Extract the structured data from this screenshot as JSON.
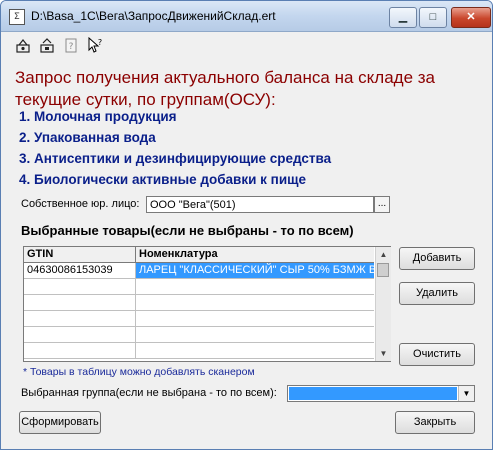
{
  "window": {
    "title": "D:\\Basa_1C\\Вега\\ЗапросДвиженийСклад.ert",
    "icon_glyph": "Σ",
    "min_glyph": "▁",
    "max_glyph": "□",
    "close_glyph": "✕"
  },
  "toolbar": {
    "icons": [
      "open-file-icon",
      "save-file-icon",
      "help-book-icon",
      "context-help-icon"
    ]
  },
  "header": {
    "title": "Запрос получения актуального баланса на складе за текущие сутки, по группам(ОСУ):"
  },
  "groups": [
    "1. Молочная продукция",
    "2. Упакованная вода",
    "3. Антисептики и дезинфицирующие средства",
    "4. Биологически активные добавки к пище"
  ],
  "legal_entity": {
    "label": "Собственное юр. лицо:",
    "value": "ООО \"Вега\"(501)",
    "button_label": "..."
  },
  "selected_goods": {
    "title": "Выбранные товары(если не выбраны - то по всем)",
    "columns": [
      "GTIN",
      "Номенклатура"
    ],
    "rows": [
      [
        "04630086153039",
        "ЛАРЕЦ \"КЛАССИЧЕСКИЙ\" СЫР 50% БЗМЖ В"
      ],
      [
        "",
        ""
      ],
      [
        "",
        ""
      ],
      [
        "",
        ""
      ],
      [
        "",
        ""
      ],
      [
        "",
        ""
      ]
    ],
    "scroll_up": "▲",
    "scroll_down": "▼"
  },
  "buttons": {
    "add": "Добавить",
    "delete": "Удалить",
    "clear": "Очистить",
    "build": "Сформировать",
    "close": "Закрыть"
  },
  "note": "* Товары в таблицу можно добавлять сканером",
  "group_select": {
    "label": "Выбранная группа(если не выбрана - то по всем):",
    "value": "",
    "arrow": "▼"
  }
}
